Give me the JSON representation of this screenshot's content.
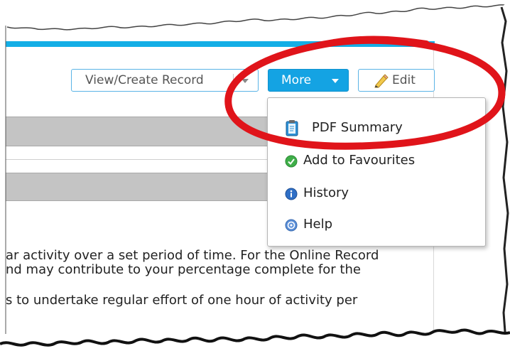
{
  "toolbar": {
    "view_create_label": "View/Create Record",
    "more_label": "More",
    "edit_label": "Edit"
  },
  "more_menu": {
    "items": [
      {
        "label": "PDF Summary",
        "icon": "clipboard-icon"
      },
      {
        "label": "Add to Favourites",
        "icon": "check-circle-icon"
      },
      {
        "label": "History",
        "icon": "info-circle-icon"
      },
      {
        "label": "Help",
        "icon": "question-circle-icon"
      }
    ]
  },
  "content": {
    "line1": "ar activity over a set period of time. For the Online Record",
    "line2": "nd may contribute to your percentage complete for the",
    "line3": "s to undertake regular effort of one hour of activity per"
  },
  "colors": {
    "accent": "#14a3e3",
    "header_bar": "#14aee6",
    "annotation": "#e0141a",
    "band": "#c4c4c4"
  }
}
